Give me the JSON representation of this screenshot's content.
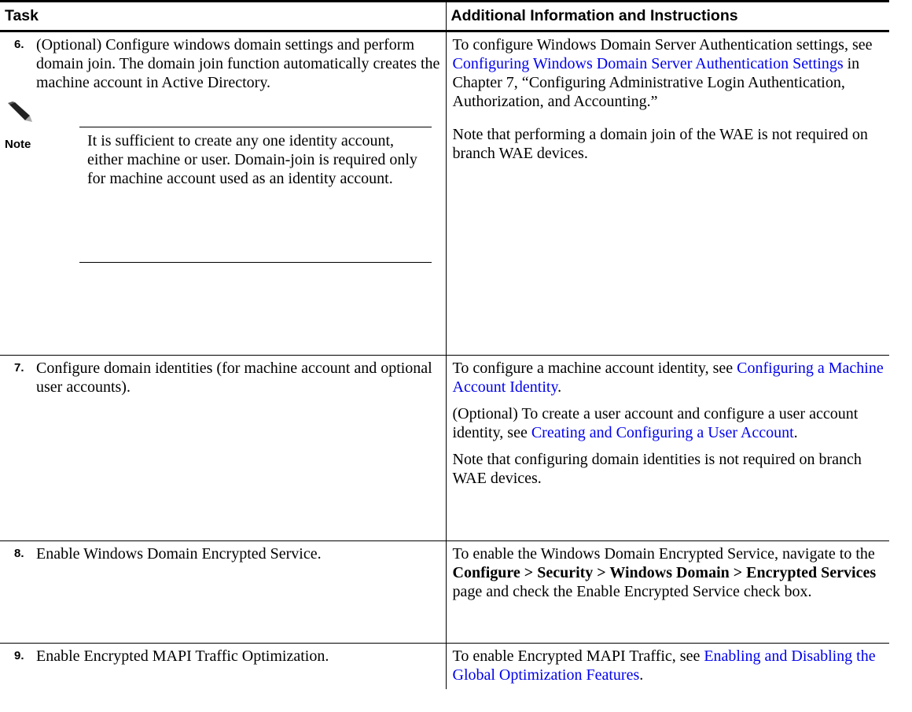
{
  "table": {
    "headers": {
      "task": "Task",
      "info": "Additional Information and Instructions"
    },
    "rows": [
      {
        "num": "6.",
        "task": "(Optional) Configure windows domain settings and perform domain join. The domain join function automatically creates the machine account in Active Directory.",
        "note": {
          "label": "Note",
          "text": "It is sufficient to create any one identity account, either machine or user. Domain-join is required only for machine account used as an identity account."
        },
        "info": {
          "p1_pre": "To configure Windows Domain Server Authentication settings, see ",
          "p1_link": "Configuring Windows Domain Server Authentication Settings",
          "p1_post": " in Chapter 7, “Configuring Administrative Login Authentication, Authorization, and Accounting.”",
          "p2": "Note that performing a domain join of the WAE is not required on branch WAE devices."
        }
      },
      {
        "num": "7.",
        "task": "Configure domain identities (for machine account and optional user accounts).",
        "info": {
          "p1_pre": "To configure a machine account identity, see ",
          "p1_link": "Configuring a Machine Account Identity",
          "p1_post": ".",
          "p2_pre": "(Optional) To create a user account and configure a user account identity, see ",
          "p2_link": "Creating and Configuring a User Account",
          "p2_post": ".",
          "p3": "Note that configuring domain identities is not required on branch WAE devices."
        }
      },
      {
        "num": "8.",
        "task": "Enable Windows Domain Encrypted Service.",
        "info": {
          "pre": "To enable the Windows Domain Encrypted Service, navigate to the ",
          "bold": "Configure > Security > Windows Domain > Encrypted Services",
          "post": " page and check the Enable Encrypted Service check box."
        }
      },
      {
        "num": "9.",
        "task": "Enable Encrypted MAPI Traffic Optimization.",
        "info": {
          "pre": "To enable Encrypted MAPI Traffic, see ",
          "link": "Enabling and Disabling the Global Optimization Features",
          "post": "."
        }
      }
    ]
  },
  "icons": {
    "note": "note-pencil-icon"
  },
  "colors": {
    "link": "#0000ee"
  }
}
